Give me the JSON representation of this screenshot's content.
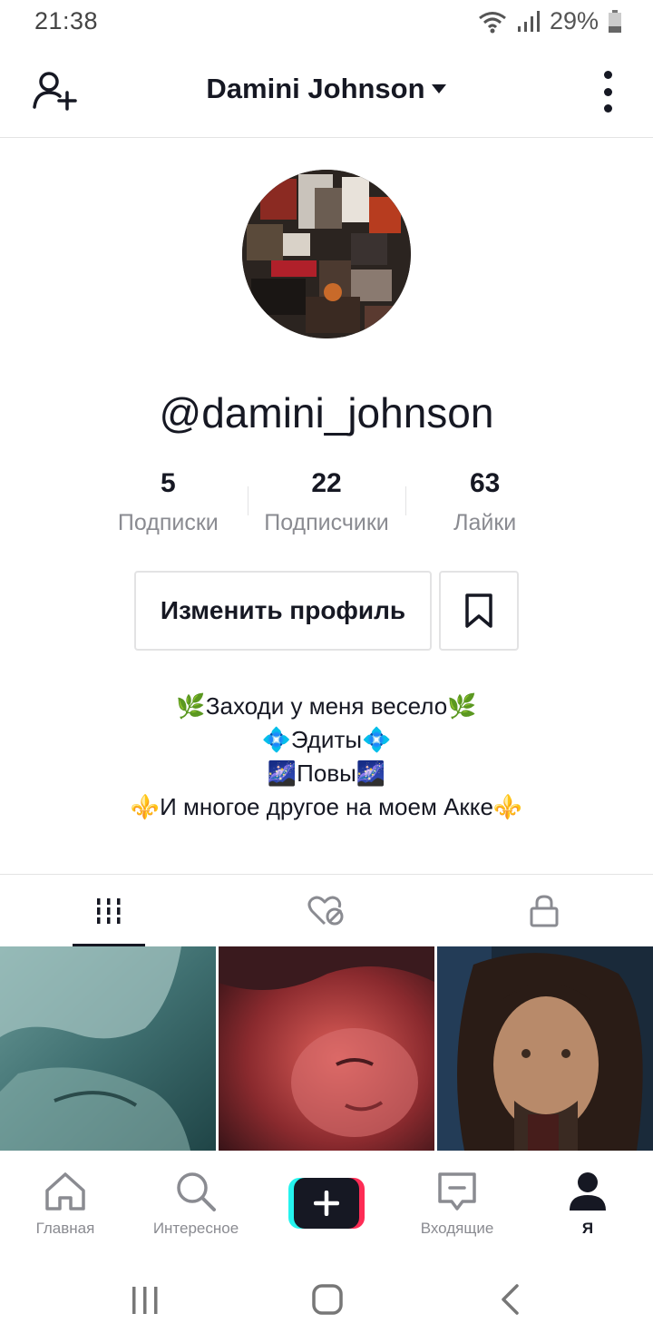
{
  "status_bar": {
    "time": "21:38",
    "battery": "29%"
  },
  "header": {
    "title": "Damini Johnson",
    "add_user_icon": "person-add-icon",
    "more_icon": "more-vertical-icon",
    "dropdown_icon": "caret-down-icon"
  },
  "profile": {
    "username": "@damini_johnson",
    "stats": [
      {
        "value": "5",
        "label": "Подписки"
      },
      {
        "value": "22",
        "label": "Подписчики"
      },
      {
        "value": "63",
        "label": "Лайки"
      }
    ],
    "edit_button": "Изменить профиль",
    "bookmark_icon": "bookmark-icon",
    "bio": [
      "🌿Заходи у меня весело🌿",
      "💠Эдиты💠",
      "🌌Повы🌌",
      "⚜️И многое другое на моем Акке⚜️"
    ]
  },
  "tabs": [
    {
      "icon": "grid-icon",
      "active": true
    },
    {
      "icon": "liked-hidden-icon",
      "active": false
    },
    {
      "icon": "lock-icon",
      "active": false
    }
  ],
  "bottom_nav": {
    "home": "Главная",
    "discover": "Интересное",
    "inbox": "Входящие",
    "me": "Я"
  },
  "colors": {
    "text": "#161823",
    "secondary": "#8a8b91",
    "border": "#e3e3e4",
    "cyan": "#25f4ee",
    "pink": "#fe2c55"
  }
}
